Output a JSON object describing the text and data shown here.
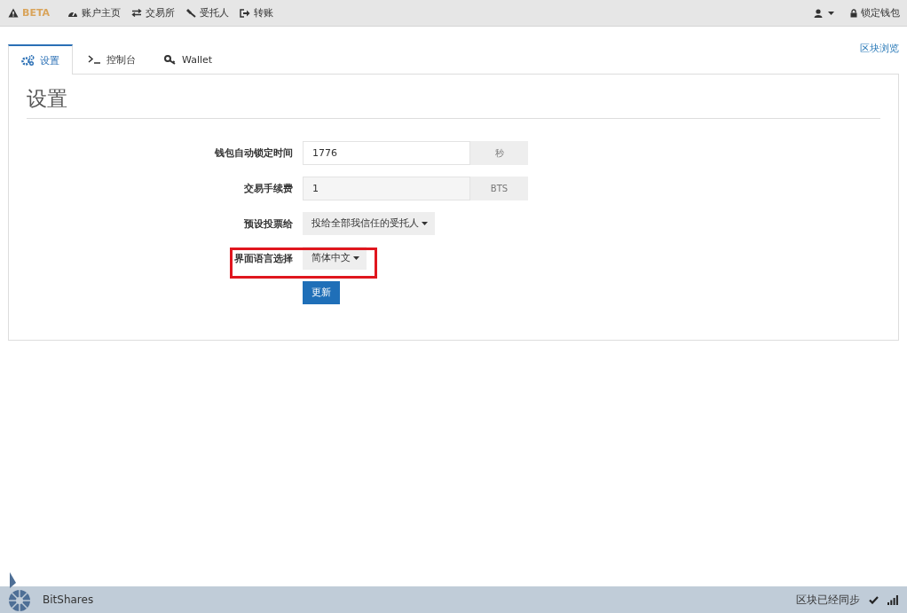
{
  "topbar": {
    "brand": "BETA",
    "nav": [
      {
        "kind": "dashboard",
        "label": "账户主页"
      },
      {
        "kind": "exchange",
        "label": "交易所"
      },
      {
        "kind": "gavel",
        "label": "受托人"
      },
      {
        "kind": "transfer",
        "label": "转账"
      }
    ],
    "lock": "锁定钱包"
  },
  "tabs": [
    {
      "kind": "gears",
      "label": "设置",
      "selected": true
    },
    {
      "kind": "console",
      "label": "控制台",
      "selected": false
    },
    {
      "kind": "key",
      "label": "Wallet",
      "selected": false
    }
  ],
  "explorer_link": "区块浏览",
  "settings": {
    "title": "设置",
    "rows": [
      {
        "kind": "input",
        "label": "钱包自动锁定时间",
        "value": "1776",
        "addon": "秒",
        "highlighted": false
      },
      {
        "kind": "input",
        "label": "交易手续费",
        "value": "1",
        "addon": "BTS",
        "highlighted": false
      },
      {
        "kind": "dropdown",
        "label": "预设投票给",
        "value": "投给全部我信任的受托人",
        "highlighted": false
      },
      {
        "kind": "dropdown",
        "label": "界面语言选择",
        "value": "简体中文",
        "highlighted": true
      }
    ],
    "submit": "更新"
  },
  "footer": {
    "brand": "BitShares",
    "sync_status": "区块已经同步"
  }
}
